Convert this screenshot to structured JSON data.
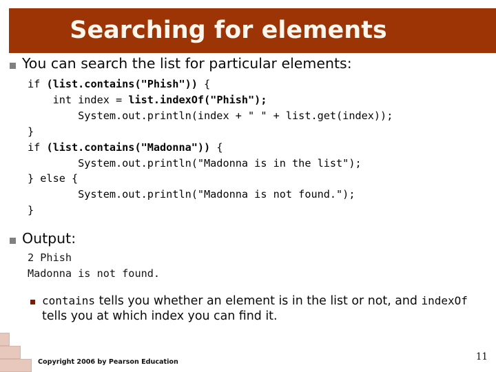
{
  "slide": {
    "title": "Searching for elements",
    "banner_color": "#9c3406",
    "title_color": "#fdf6ec"
  },
  "main_bullet": {
    "marker": "square-bullet-icon",
    "text": "You can search the list for particular elements:"
  },
  "code": {
    "lines": [
      [
        {
          "t": "if ",
          "bold": false
        },
        {
          "t": "(list.contains(\"Phish\")) ",
          "bold": true
        },
        {
          "t": "{",
          "bold": false
        }
      ],
      [
        {
          "t": "    int index = ",
          "bold": false
        },
        {
          "t": "list.indexOf(\"Phish\");",
          "bold": true
        }
      ],
      [
        {
          "t": "        System.out.println(index + \" \" + list.get(index));",
          "bold": false
        }
      ],
      [
        {
          "t": "}",
          "bold": false
        }
      ],
      [
        {
          "t": "if ",
          "bold": false
        },
        {
          "t": "(list.contains(\"Madonna\")) ",
          "bold": true
        },
        {
          "t": "{",
          "bold": false
        }
      ],
      [
        {
          "t": "        System.out.println(\"Madonna is in the list\");",
          "bold": false
        }
      ],
      [
        {
          "t": "} else {",
          "bold": false
        }
      ],
      [
        {
          "t": "        System.out.println(\"Madonna is not found.\");",
          "bold": false
        }
      ],
      [
        {
          "t": "}",
          "bold": false
        }
      ]
    ]
  },
  "output_bullet": {
    "marker": "square-bullet-icon",
    "label": "Output:",
    "lines": [
      "2 Phish",
      "Madonna is not found."
    ]
  },
  "sub_bullet": {
    "marker": "square-bullet-icon-red",
    "marker_color": "#7b1c06",
    "parts": [
      {
        "t": "contains",
        "mono": true
      },
      {
        "t": " tells you whether an element is in the list or not, and ",
        "mono": false
      },
      {
        "t": "indexOf",
        "mono": true
      },
      {
        "t": " tells you at which index you can find it.",
        "mono": false
      }
    ]
  },
  "footer": {
    "copyright": "Copyright 2006 by Pearson Education",
    "page_number": "11",
    "decoration": "stair-steps-graphic"
  }
}
